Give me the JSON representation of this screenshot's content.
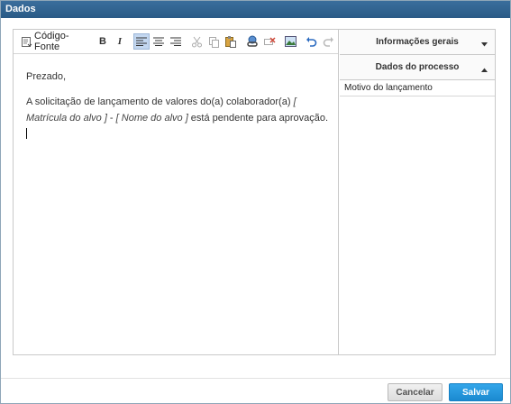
{
  "window": {
    "title": "Dados"
  },
  "toolbar": {
    "source_label": "Código-Fonte",
    "bold_label": "B",
    "italic_label": "I"
  },
  "editor": {
    "greeting": "Prezado,",
    "text_before": "A solicitação de lançamento de valores do(a) colaborador(a) ",
    "placeholder_1": "[ Matrícula do alvo ]",
    "text_between": " - ",
    "placeholder_2": "[ Nome do alvo ]",
    "text_after": " está pendente para aprovação."
  },
  "side_panel": {
    "sections": [
      {
        "title": "Informações gerais",
        "expanded": false,
        "items": []
      },
      {
        "title": "Dados do processo",
        "expanded": true,
        "items": [
          "Motivo do lançamento"
        ]
      }
    ]
  },
  "footer": {
    "cancel_label": "Cancelar",
    "save_label": "Salvar"
  },
  "colors": {
    "title_bar": "#2e6290",
    "save_button": "#1b8ad0",
    "active_tool": "#c3d7f0"
  }
}
